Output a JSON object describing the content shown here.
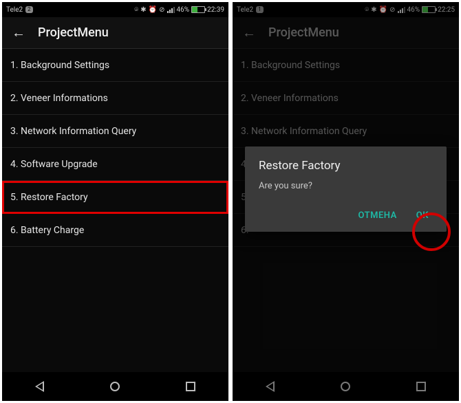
{
  "left": {
    "status": {
      "carrier": "Tele2",
      "sim": "2",
      "battery": "46%",
      "time": "22:39"
    },
    "title": "ProjectMenu",
    "items": [
      "1. Background Settings",
      "2. Veneer Informations",
      "3. Network Information Query",
      "4. Software Upgrade",
      "5. Restore Factory",
      "6. Battery Charge"
    ],
    "highlight_index": 4
  },
  "right": {
    "status": {
      "carrier": "Tele2",
      "sim": "1",
      "battery": "46%",
      "time": "22:25"
    },
    "title": "ProjectMenu",
    "items": [
      "1. Background Settings",
      "2. Veneer Informations",
      "3. Network Information Query",
      "4.",
      "5.",
      "6."
    ],
    "dialog": {
      "title": "Restore Factory",
      "message": "Are you sure?",
      "cancel": "ОТМЕНА",
      "ok": "OK"
    }
  }
}
